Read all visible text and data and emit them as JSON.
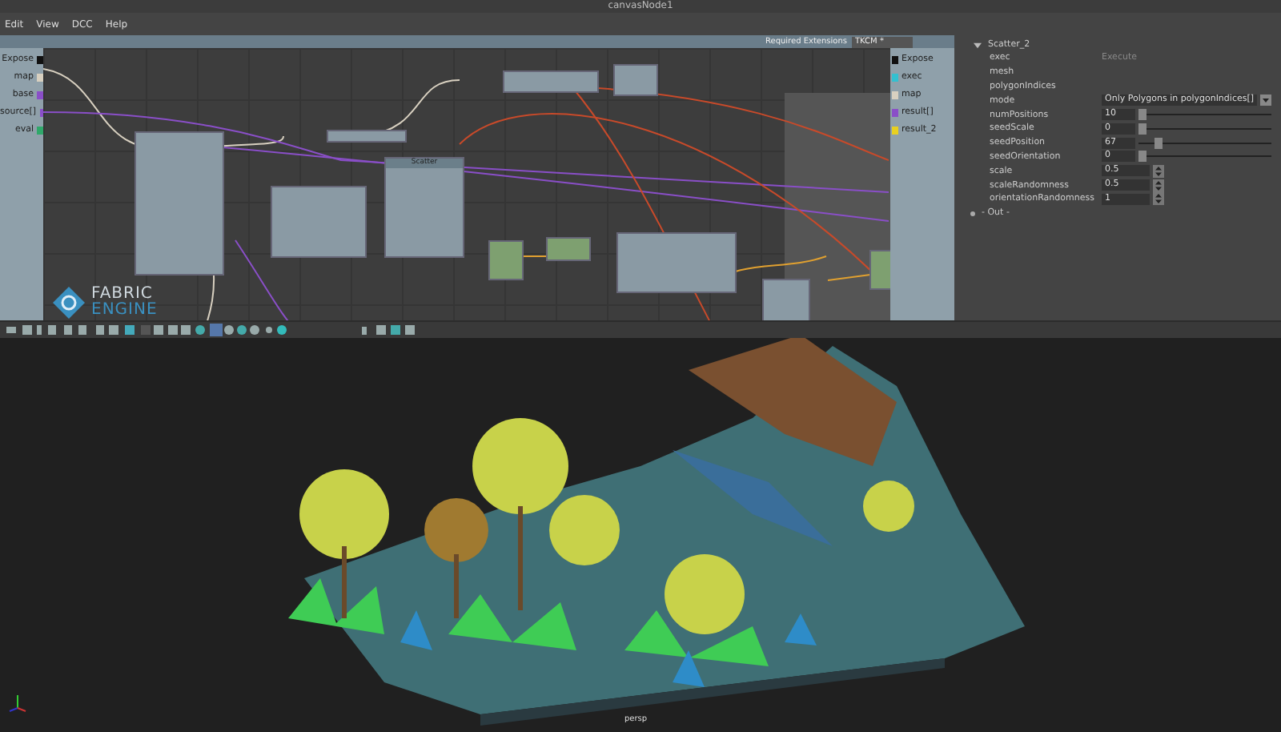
{
  "window": {
    "title": "canvasNode1"
  },
  "menu": [
    "Edit",
    "View",
    "DCC",
    "Help"
  ],
  "graph": {
    "required_extensions_label": "Required Extensions",
    "extension": "TKCM *",
    "left_ports": [
      {
        "name": "Expose",
        "color": "#111111"
      },
      {
        "name": "map",
        "color": "#d8d0c0"
      },
      {
        "name": "base",
        "color": "#8a4fc8"
      },
      {
        "name": "source[]",
        "color": "#8a4fc8"
      },
      {
        "name": "eval",
        "color": "#2fa86a"
      }
    ],
    "right_ports": [
      {
        "name": "Expose",
        "color": "#111111"
      },
      {
        "name": "exec",
        "color": "#33c0d0"
      },
      {
        "name": "map",
        "color": "#d8d0c0"
      },
      {
        "name": "result[]",
        "color": "#8a4fc8"
      },
      {
        "name": "result_2",
        "color": "#e8d020"
      }
    ],
    "nodes": [
      {
        "kind": "function"
      },
      {
        "kind": "function"
      },
      {
        "kind": "function"
      },
      {
        "kind": "function"
      },
      {
        "kind": "function"
      },
      {
        "kind": "function",
        "title": "Scatter"
      },
      {
        "kind": "math"
      },
      {
        "kind": "math"
      },
      {
        "kind": "function"
      },
      {
        "kind": "function"
      },
      {
        "kind": "math"
      }
    ],
    "logo": {
      "line_1": "FABRIC",
      "line_2": "ENGINE"
    }
  },
  "properties": {
    "title": "Scatter_2",
    "expanded": true,
    "rows": [
      {
        "kind": "button",
        "label": "exec",
        "value": "Execute"
      },
      {
        "kind": "empty",
        "label": "mesh"
      },
      {
        "kind": "empty",
        "label": "polygonIndices"
      },
      {
        "kind": "dropdown",
        "label": "mode",
        "value": "Only Polygons in polygonIndices[]"
      },
      {
        "kind": "slider",
        "label": "numPositions",
        "value": "10",
        "level": 0
      },
      {
        "kind": "slider",
        "label": "seedScale",
        "value": "0",
        "level": 0
      },
      {
        "kind": "slider",
        "label": "seedPosition",
        "value": "67",
        "level": 0.12
      },
      {
        "kind": "slider",
        "label": "seedOrientation",
        "value": "0",
        "level": 0
      },
      {
        "kind": "spinner",
        "label": "scale",
        "value": "0.5"
      },
      {
        "kind": "spinner",
        "label": "scaleRandomness",
        "value": "0.5"
      },
      {
        "kind": "spinner",
        "label": "orientationRandomness",
        "value": "1"
      }
    ],
    "out_group": {
      "label": "- Out -",
      "expanded": false
    }
  },
  "viewport": {
    "camera": "persp"
  }
}
